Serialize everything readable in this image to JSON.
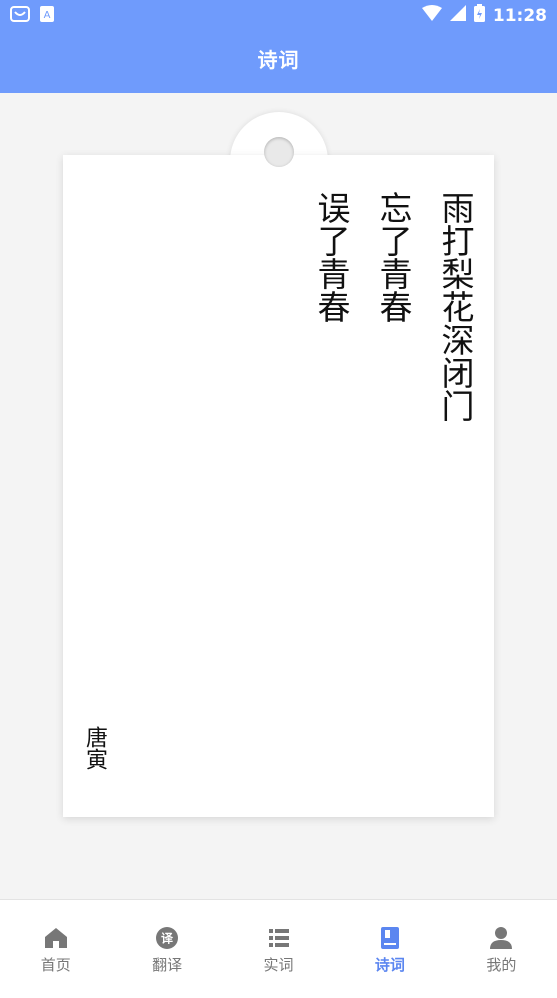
{
  "status_bar": {
    "time": "11:28"
  },
  "header": {
    "title": "诗词"
  },
  "poem": {
    "lines": [
      "雨打梨花深闭门",
      "忘了青春",
      "误了青春"
    ],
    "author": "唐寅"
  },
  "bottom_nav": {
    "items": [
      {
        "label": "首页",
        "icon": "home-icon"
      },
      {
        "label": "翻译",
        "icon": "translate-icon"
      },
      {
        "label": "实词",
        "icon": "list-icon"
      },
      {
        "label": "诗词",
        "icon": "book-icon",
        "active": true
      },
      {
        "label": "我的",
        "icon": "user-icon"
      }
    ]
  },
  "colors": {
    "accent": "#6f9bfc",
    "active": "#5b86f0"
  }
}
